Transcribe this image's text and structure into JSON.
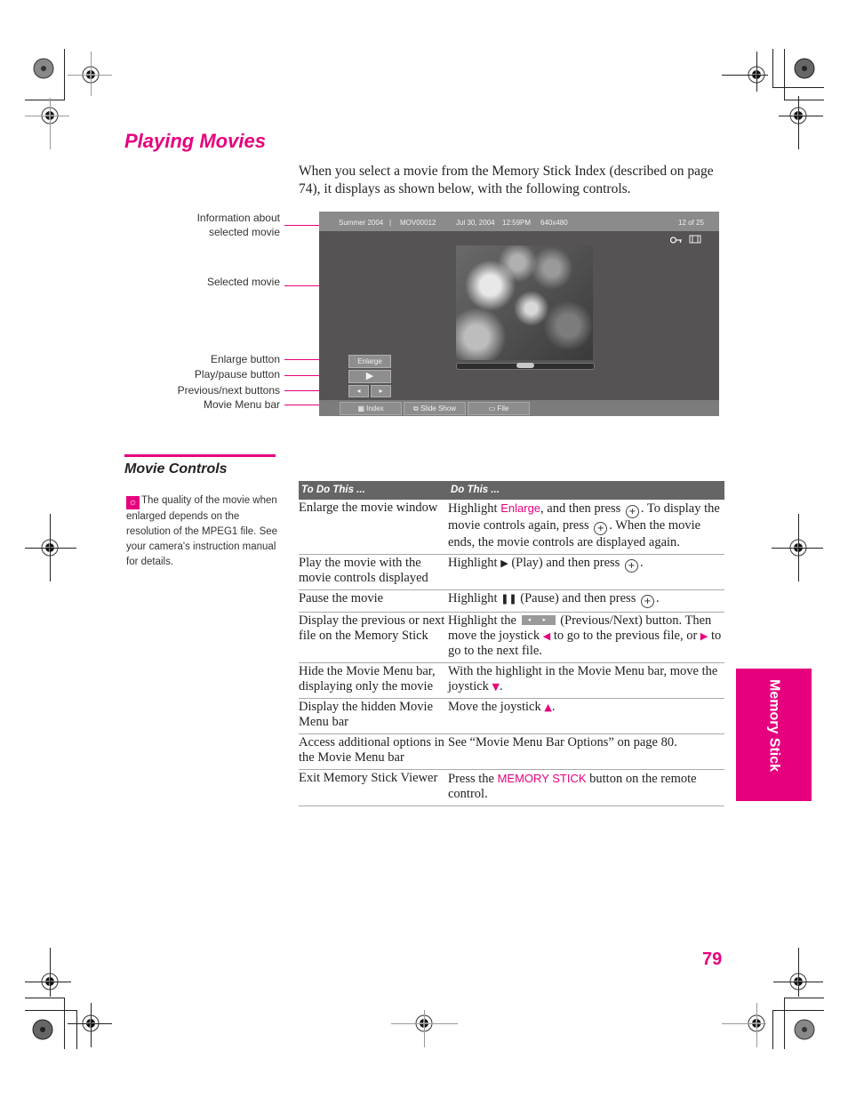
{
  "page": {
    "title": "Playing Movies",
    "intro": "When you select a movie from the Memory Stick Index (described on page 74), it displays as shown below, with the following controls.",
    "page_number": "79",
    "side_tab": "Memory Stick",
    "accent_color": "#e6007e"
  },
  "screen": {
    "info_bar": {
      "album": "Summer 2004",
      "separator": "|",
      "file": "MOV00012",
      "date": "Jul 30, 2004",
      "time": "12:59PM",
      "resolution": "640x480",
      "counter": "12 of 25"
    },
    "status_icons": [
      "key-icon",
      "film-icon"
    ],
    "status_glyphs": "⚷ 🎞",
    "playback_progress_fraction": 0.5,
    "controls": {
      "enlarge_label": "Enlarge",
      "play_glyph": "▶",
      "prev_glyph": "◂",
      "next_glyph": "▸"
    },
    "menu_bar": [
      {
        "label": "Index",
        "icon": "grid-icon",
        "glyph": "▦"
      },
      {
        "label": "Slide Show",
        "icon": "slideshow-icon",
        "glyph": "⧉"
      },
      {
        "label": "File",
        "icon": "file-icon",
        "glyph": "▭"
      }
    ]
  },
  "callouts": [
    {
      "label": "Information about selected movie",
      "line1": "Information about",
      "line2": "selected movie"
    },
    {
      "label": "Selected movie"
    },
    {
      "label": "Enlarge button"
    },
    {
      "label": "Play/pause button"
    },
    {
      "label": "Previous/next buttons"
    },
    {
      "label": "Movie Menu bar"
    }
  ],
  "movie_controls": {
    "heading": "Movie Controls",
    "tip_icon": "lightbulb-icon",
    "tip_glyph": "💡",
    "tip": "The quality of the movie when enlarged depends on the resolution of the MPEG1 file. See your camera's instruction manual for details.",
    "table": {
      "headers": [
        "To Do This ...",
        "Do This ..."
      ],
      "rows": [
        {
          "action": "Enlarge the movie window",
          "p1": "Highlight ",
          "k1": "Enlarge",
          "p2": ", and then press ",
          "p3": ". To display the movie controls again, press ",
          "p4": ". When the movie ends, the movie controls are displayed again."
        },
        {
          "action": "Play the movie with the movie controls displayed",
          "p1": "Highlight ",
          "glyph": "▶",
          "p2": " (Play) and then press ",
          "p3": "."
        },
        {
          "action": "Pause the movie",
          "p1": "Highlight ",
          "glyph": "❚❚",
          "p2": " (Pause) and then press ",
          "p3": "."
        },
        {
          "action": "Display the previous or next file on the Memory Stick",
          "p1": "Highlight the ",
          "p2": " (Previous/Next) button. Then move the joystick ",
          "left_arrow": "◀",
          "p3": " to go to the previous file, or ",
          "right_arrow": "▶",
          "p4": " to go to the next file."
        },
        {
          "action": "Hide the Movie Menu bar, displaying only the movie",
          "p1": "With the highlight in the Movie Menu bar, move the joystick ",
          "down_arrow": "▼",
          "p2": "."
        },
        {
          "action": "Display the hidden Movie Menu bar",
          "p1": "Move the joystick ",
          "up_arrow": "▲",
          "p2": "."
        },
        {
          "action": "Access additional options in the Movie Menu bar",
          "p1": "See “Movie Menu Bar Options” on page 80."
        },
        {
          "action": "Exit Memory Stick Viewer",
          "p1": "Press the ",
          "k1": "MEMORY STICK",
          "p2": " button on the remote control."
        }
      ]
    },
    "joystick_glyph": "+"
  }
}
